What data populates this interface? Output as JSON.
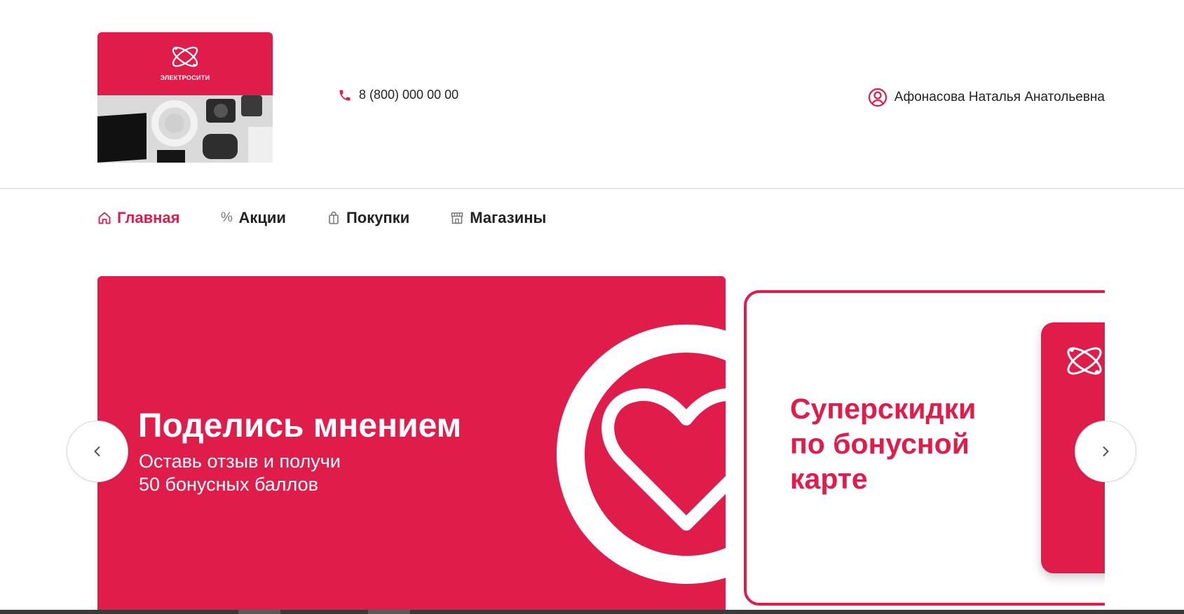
{
  "header": {
    "logo": {
      "brand_text": "ЭЛЕКТРОСИТИ",
      "accent_color": "#e01c4a"
    },
    "phone": {
      "icon": "phone-icon",
      "number": "8 (800) 000 00 00"
    },
    "user": {
      "icon": "user-circle-icon",
      "name": "Афонасова Наталья Анатольевна"
    }
  },
  "nav": {
    "items": [
      {
        "icon": "home-icon",
        "label": "Главная",
        "active": true
      },
      {
        "icon": "percent-icon",
        "glyph": "%",
        "label": "Акции",
        "active": false
      },
      {
        "icon": "shopping-bag-icon",
        "label": "Покупки",
        "active": false
      },
      {
        "icon": "store-icon",
        "label": "Магазины",
        "active": false
      }
    ]
  },
  "carousel": {
    "slides": [
      {
        "title": "Поделись мнением",
        "subtitle_line1": "Оставь отзыв и получи",
        "subtitle_line2": "50 бонусных баллов",
        "icon": "heart-icon"
      },
      {
        "title_line1": "Суперскидки",
        "title_line2": "по бонусной",
        "title_line3": "карте",
        "icon": "bonus-card-icon"
      }
    ],
    "prev_icon": "chevron-left-icon",
    "next_icon": "chevron-right-icon"
  },
  "colors": {
    "accent": "#e01c4a",
    "text": "#222222",
    "divider": "#e6e6e6"
  }
}
